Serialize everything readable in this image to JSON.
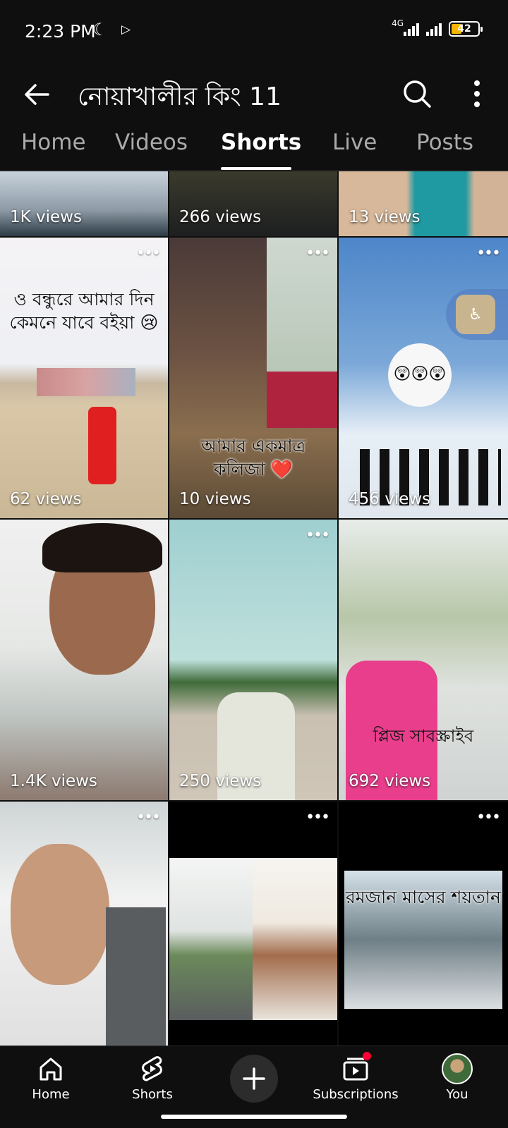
{
  "status_bar": {
    "time": "2:23 PM",
    "network": "4G",
    "battery": "42"
  },
  "header": {
    "channel_title": "নোয়াখালীর কিং 11",
    "icons": [
      "back-arrow-icon",
      "search-icon",
      "more-vert-icon"
    ]
  },
  "tabs": [
    {
      "label": "Home",
      "active": false
    },
    {
      "label": "Videos",
      "active": false
    },
    {
      "label": "Shorts",
      "active": true
    },
    {
      "label": "Live",
      "active": false
    },
    {
      "label": "Posts",
      "active": false
    }
  ],
  "shorts": [
    {
      "views": "1K views",
      "overlay": ""
    },
    {
      "views": "266 views",
      "overlay": ""
    },
    {
      "views": "13 views",
      "overlay": ""
    },
    {
      "views": "62 views",
      "overlay": "ও বন্ধুরে আমার দিন কেমনে যাবে বইয়া 😢"
    },
    {
      "views": "10 views",
      "overlay": "আমার একমাত্র কলিজা ❤️"
    },
    {
      "views": "456 views",
      "overlay": "😲😲😲"
    },
    {
      "views": "1.4K views",
      "overlay": ""
    },
    {
      "views": "250 views",
      "overlay": ""
    },
    {
      "views": "692 views",
      "overlay": "প্লিজ সাবস্ক্রাইব"
    },
    {
      "views": "",
      "overlay": ""
    },
    {
      "views": "",
      "overlay": ""
    },
    {
      "views": "",
      "overlay": "রমজান মাসের শয়তান"
    }
  ],
  "bottom_nav": {
    "home": "Home",
    "shorts": "Shorts",
    "subscriptions": "Subscriptions",
    "you": "You"
  },
  "colors": {
    "background": "#0f0f0f",
    "active_tab": "#ffffff",
    "inactive_tab": "#aaaaaa",
    "notification": "#ff0033"
  }
}
